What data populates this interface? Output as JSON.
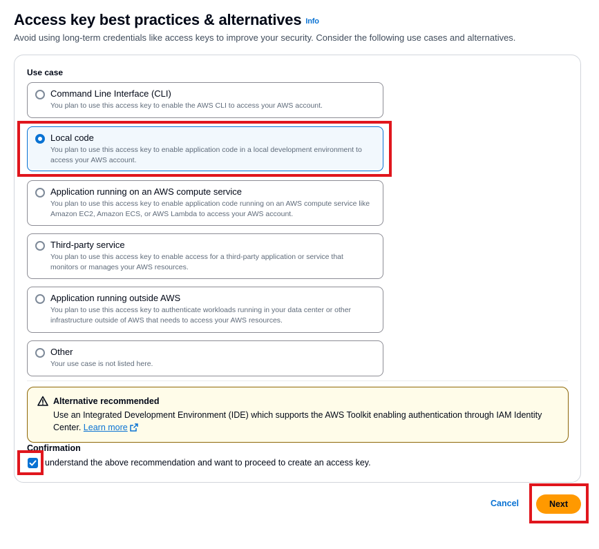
{
  "header": {
    "title": "Access key best practices & alternatives",
    "info_label": "Info",
    "subtitle": "Avoid using long-term credentials like access keys to improve your security. Consider the following use cases and alternatives."
  },
  "use_case": {
    "label": "Use case",
    "selected": "Local code",
    "options": [
      {
        "title": "Command Line Interface (CLI)",
        "desc": "You plan to use this access key to enable the AWS CLI to access your AWS account."
      },
      {
        "title": "Local code",
        "desc": "You plan to use this access key to enable application code in a local development environment to access your AWS account."
      },
      {
        "title": "Application running on an AWS compute service",
        "desc": "You plan to use this access key to enable application code running on an AWS compute service like Amazon EC2, Amazon ECS, or AWS Lambda to access your AWS account."
      },
      {
        "title": "Third-party service",
        "desc": "You plan to use this access key to enable access for a third-party application or service that monitors or manages your AWS resources."
      },
      {
        "title": "Application running outside AWS",
        "desc": "You plan to use this access key to authenticate workloads running in your data center or other infrastructure outside of AWS that needs to access your AWS resources."
      },
      {
        "title": "Other",
        "desc": "Your use case is not listed here."
      }
    ]
  },
  "alert": {
    "title": "Alternative recommended",
    "body": "Use an Integrated Development Environment (IDE) which supports the AWS Toolkit enabling authentication through IAM Identity Center.",
    "link_label": "Learn more",
    "icon": "warning-icon"
  },
  "confirmation": {
    "label": "Confirmation",
    "checkbox_text": "understand the above recommendation and want to proceed to create an access key.",
    "checked": true
  },
  "actions": {
    "cancel_label": "Cancel",
    "next_label": "Next"
  },
  "colors": {
    "accent": "#0972d3",
    "primary_button": "#ff9900",
    "highlight": "#e0161d",
    "warning_bg": "#fffce9"
  }
}
